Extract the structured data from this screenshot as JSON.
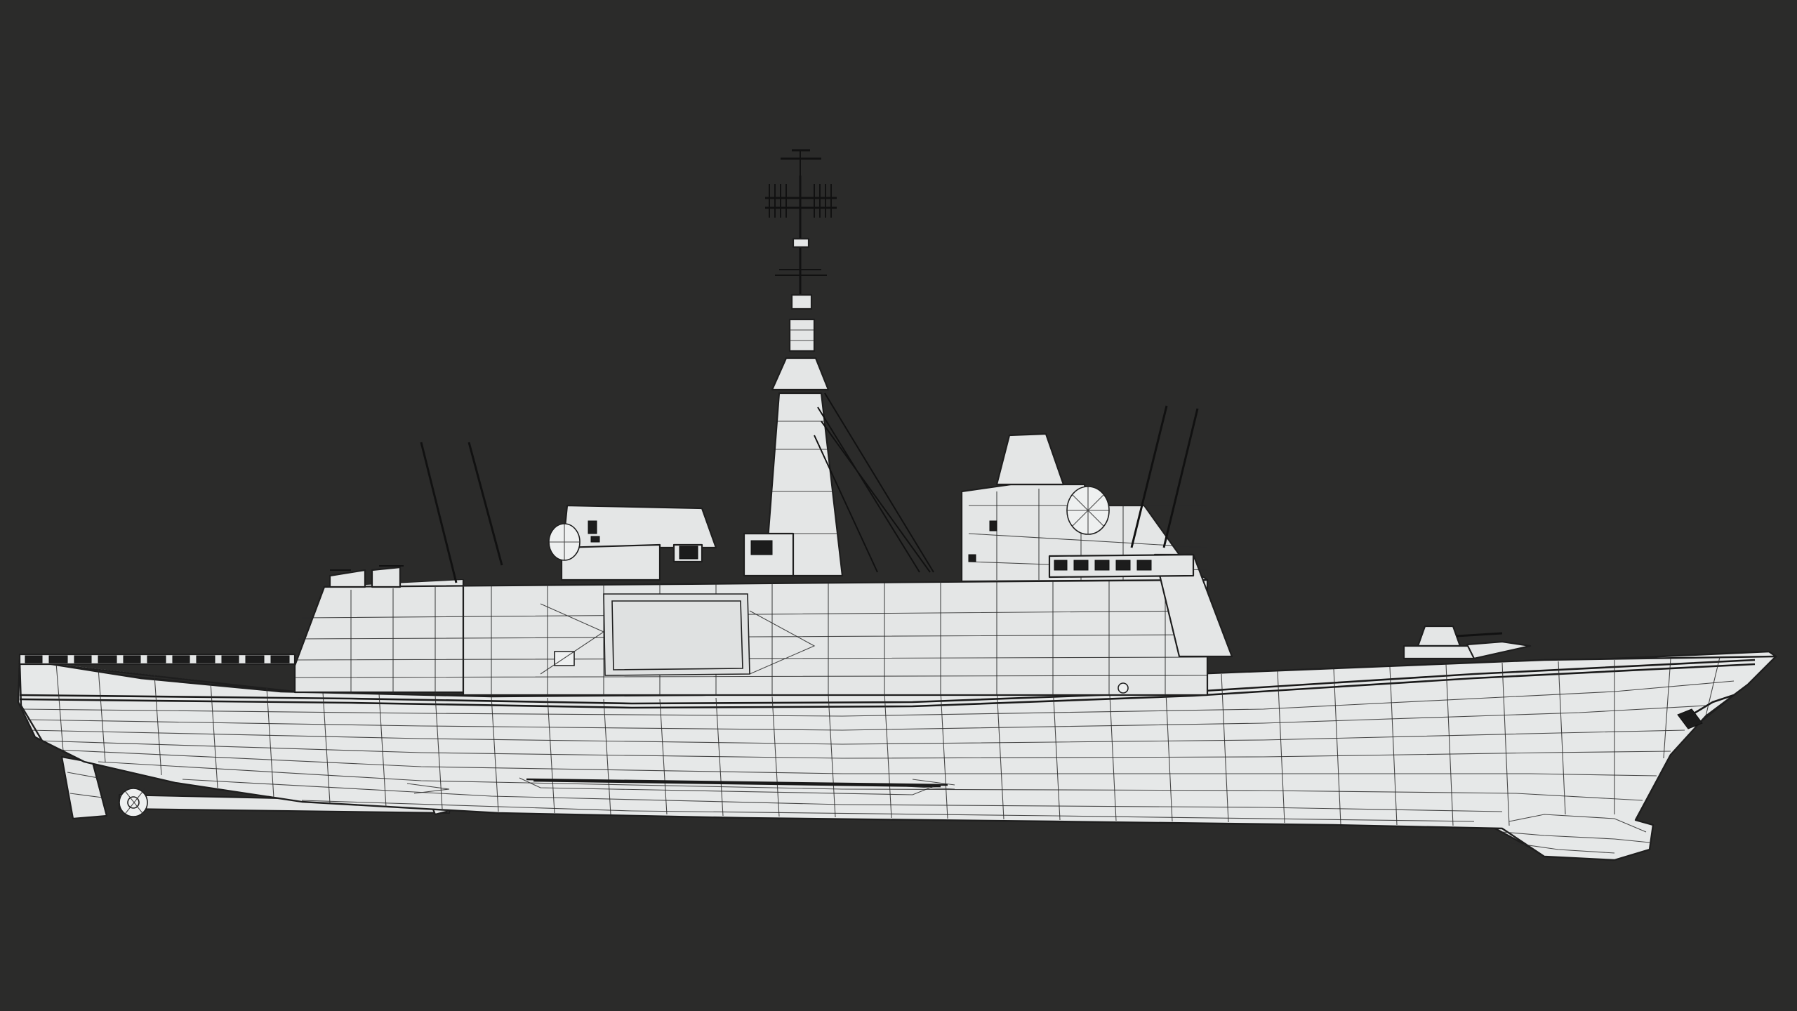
{
  "scene": {
    "background_color": "#2b2b2a",
    "model_fill_color": "#e6e8e8",
    "wireframe_color": "#1e1e1e",
    "view": "side",
    "render_style": "wireframe-on-shaded"
  }
}
